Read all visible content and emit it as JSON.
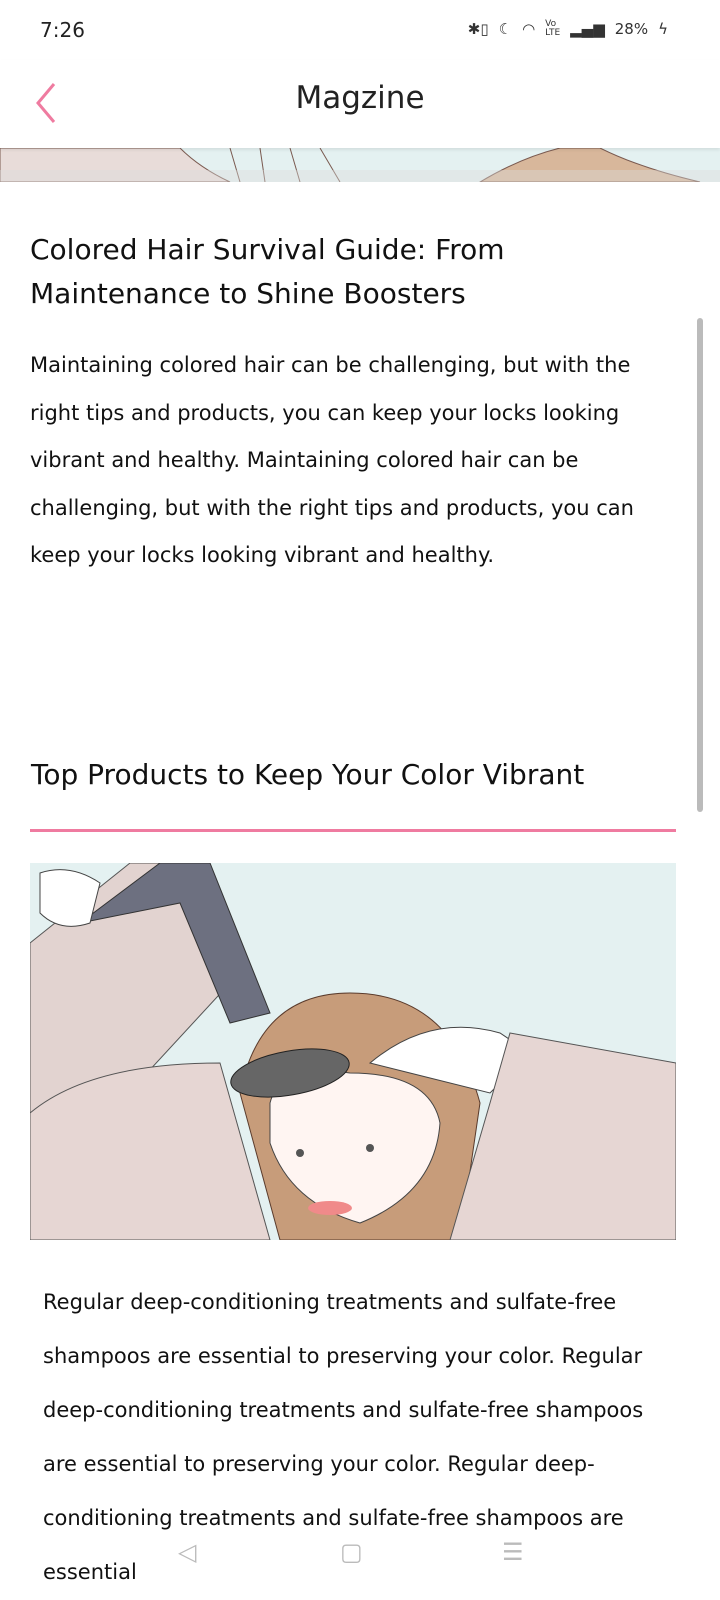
{
  "status_bar": {
    "time": "7:26",
    "battery": "28%",
    "icons": [
      "bluetooth-icon",
      "dnd-moon-icon",
      "wifi-icon",
      "volte-icon",
      "signal-icon",
      "charging-icon"
    ]
  },
  "header": {
    "title": "Magzine",
    "back_icon": "chevron-left-icon"
  },
  "article": {
    "title": "Colored Hair Survival Guide: From Maintenance to Shine Boosters",
    "intro": "Maintaining colored hair can be challenging, but with the right tips and products, you can keep your locks looking vibrant and healthy. Maintaining colored hair can be challenging, but with the right tips and products, you can keep your locks looking vibrant and healthy.",
    "section_title": "Top Products to Keep Your Color Vibrant",
    "section_body": "Regular deep-conditioning treatments and sulfate-free shampoos are essential to preserving your color. Regular deep-conditioning treatments and sulfate-free shampoos are essential to preserving your color. Regular deep-conditioning treatments and sulfate-free shampoos are essential"
  },
  "colors": {
    "accent": "#ef7ba0",
    "image_bg": "#e4f1f1"
  }
}
